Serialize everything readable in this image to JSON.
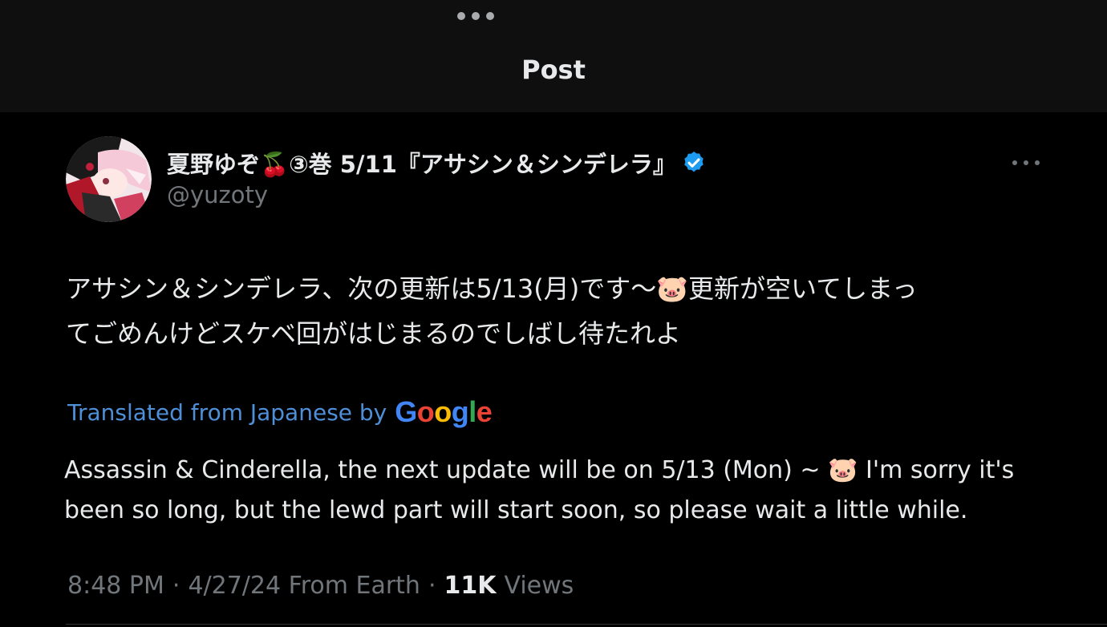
{
  "header": {
    "title": "Post"
  },
  "author": {
    "display_name": "夏野ゆぞ🍒③巻 5/11『アサシン＆シンデレラ』",
    "handle": "@yuzoty",
    "verified_icon": "verified-badge-icon",
    "verified_color": "#1d9bf0"
  },
  "post": {
    "original_line1": "アサシン＆シンデレラ、次の更新は5/13(月)です〜🐷更新が空いてしまっ",
    "original_line2": "てごめんけどスケベ回がはじまるのでしばし待たれよ",
    "translation_label": "Translated from Japanese by",
    "translation_provider": "Google",
    "translated_line1": "Assassin & Cinderella, the next update will be on 5/13 (Mon) ~ 🐷 I'm sorry it's",
    "translated_line2": "been so long, but the lewd part will start soon, so please wait a little while."
  },
  "meta": {
    "time": "8:48 PM",
    "separator": "·",
    "date_source": "4/27/24 From Earth",
    "views_count": "11K",
    "views_label": "Views"
  },
  "colors": {
    "background": "#000000",
    "header_bg": "#0f0f0f",
    "text_primary": "#e7e9ea",
    "text_secondary": "#71767b",
    "link": "#4f8fd8"
  }
}
